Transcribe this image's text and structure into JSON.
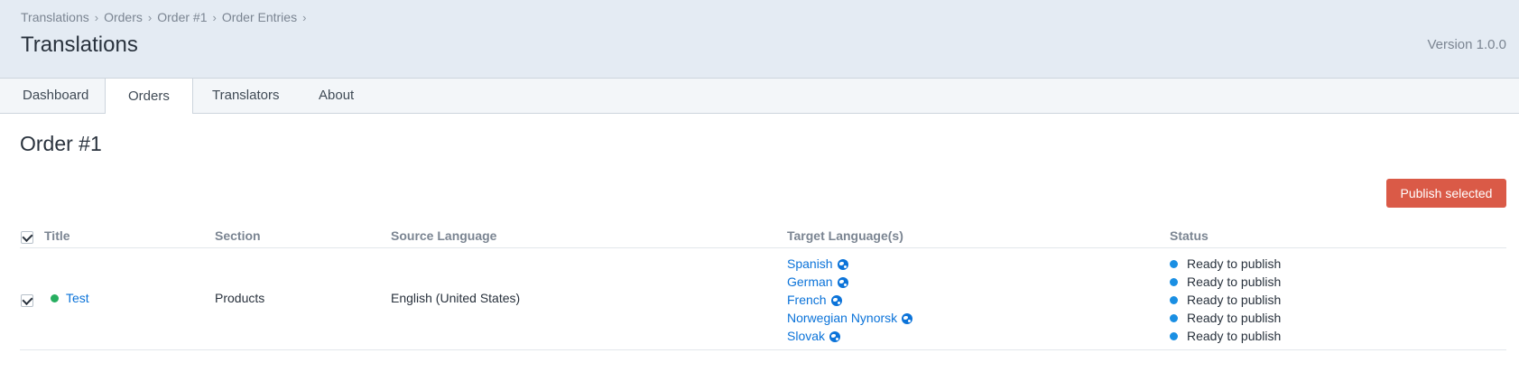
{
  "header": {
    "breadcrumbs": [
      "Translations",
      "Orders",
      "Order #1",
      "Order Entries"
    ],
    "title": "Translations",
    "version": "Version 1.0.0"
  },
  "tabs": [
    {
      "label": "Dashboard",
      "active": false
    },
    {
      "label": "Orders",
      "active": true
    },
    {
      "label": "Translators",
      "active": false
    },
    {
      "label": "About",
      "active": false
    }
  ],
  "order": {
    "title": "Order #1",
    "publish_label": "Publish selected"
  },
  "table": {
    "headers": {
      "title": "Title",
      "section": "Section",
      "source_language": "Source Language",
      "target_languages": "Target Language(s)",
      "status": "Status"
    },
    "rows": [
      {
        "checked": true,
        "title": "Test",
        "section": "Products",
        "source_language": "English (United States)",
        "target_languages": [
          "Spanish",
          "German",
          "French",
          "Norwegian Nynorsk",
          "Slovak"
        ],
        "statuses": [
          "Ready to publish",
          "Ready to publish",
          "Ready to publish",
          "Ready to publish",
          "Ready to publish"
        ]
      }
    ]
  },
  "icons": {
    "breadcrumb_separator": "chevron-right-icon",
    "select_all": "checkbox-icon",
    "entry_status": "green-dot-icon",
    "language": "globe-icon",
    "status": "blue-dot-icon"
  },
  "colors": {
    "header_bg": "#e4ebf3",
    "accent_link": "#0b73d9",
    "publish_button": "#da5a47",
    "entry_dot": "#27ae60",
    "status_dot": "#1a8fe3"
  }
}
